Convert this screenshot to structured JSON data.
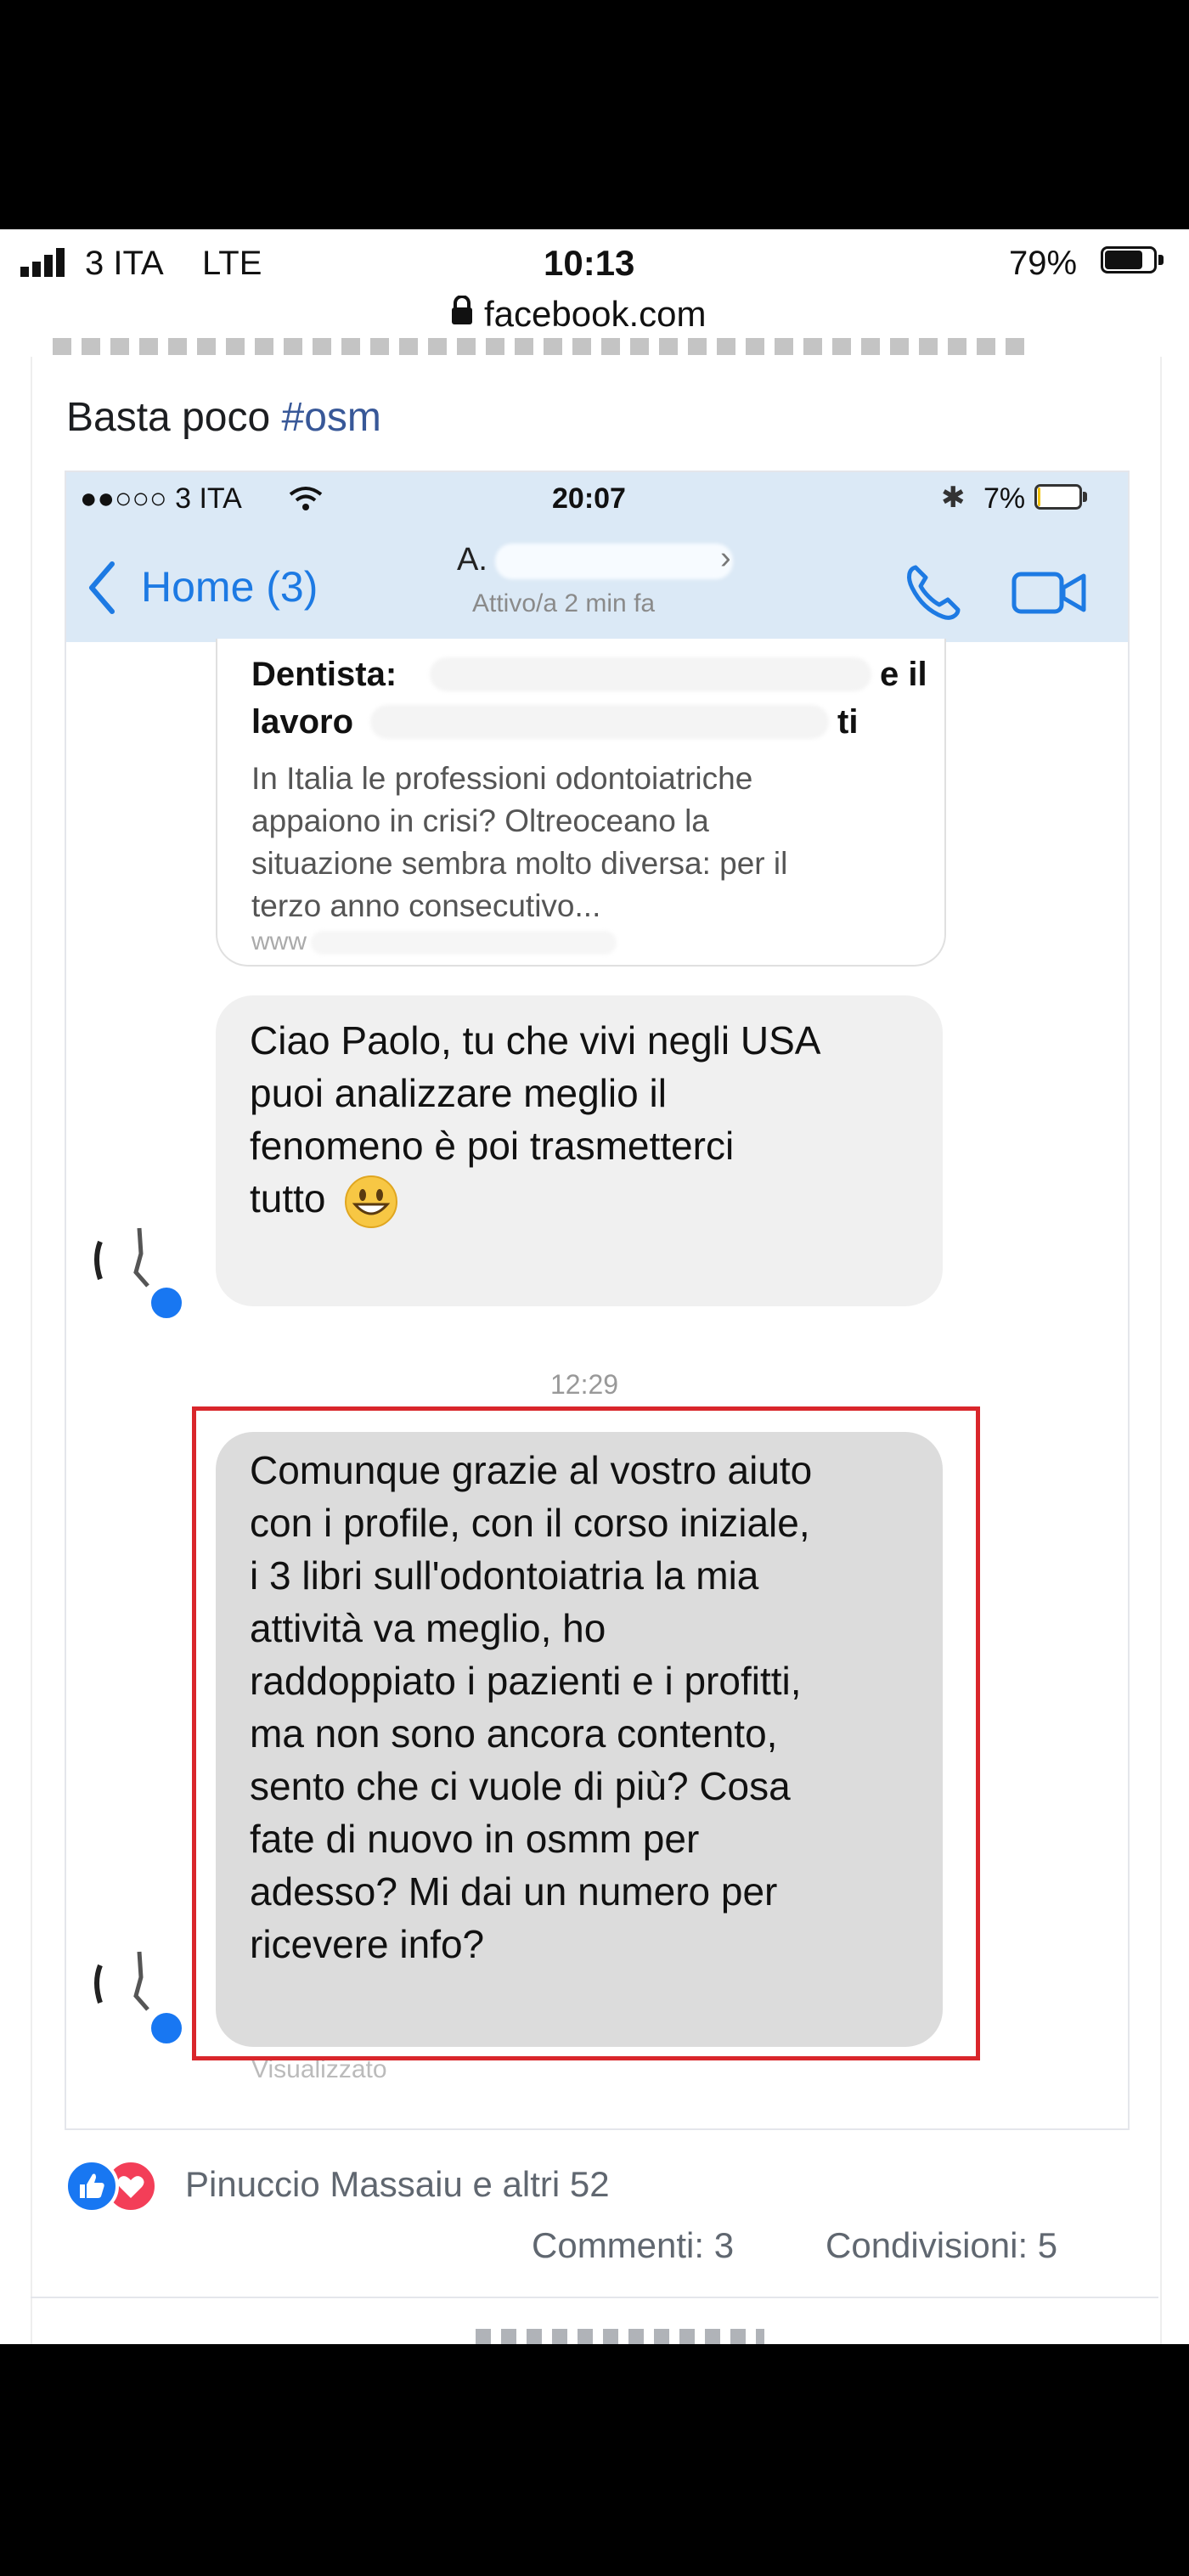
{
  "status_bar": {
    "carrier": "3 ITA",
    "network": "LTE",
    "time": "10:13",
    "battery_percent": "79%",
    "battery_level": 0.79,
    "url": "facebook.com"
  },
  "post": {
    "text_prefix": "Basta poco ",
    "hashtag": "#osm"
  },
  "inner_screenshot": {
    "status": {
      "carrier": "●●○○○ 3 ITA",
      "time": "20:07",
      "battery_percent": "7%",
      "battery_level": 0.07
    },
    "nav": {
      "back_label": "Home (3)",
      "contact_name": "A.",
      "contact_status": "Attivo/a 2 min fa"
    },
    "link_card": {
      "title_line1": "Dentista:",
      "title_line1_end": "e il",
      "title_line2": "lavoro",
      "title_line2_end": "ti",
      "description": [
        "In Italia le professioni odontoiatriche",
        "appaiono in crisi? Oltreoceano la",
        "situazione sembra molto diversa: per il",
        "terzo anno consecutivo..."
      ],
      "url": "www"
    },
    "messages": [
      {
        "lines": [
          "Ciao Paolo, tu che vivi negli USA",
          "puoi analizzare meglio il",
          "fenomeno è poi trasmetterci",
          "tutto"
        ],
        "emoji": "smiling-face"
      },
      {
        "lines": [
          "Comunque grazie al vostro aiuto",
          "con i profile, con il corso iniziale,",
          "i 3 libri sull'odontoiatria la mia",
          "attività va meglio, ho",
          "raddoppiato i pazienti e i profitti,",
          "ma non sono ancora contento,",
          "sento che ci vuole di più? Cosa",
          "fate di nuovo in osmm per",
          "adesso? Mi dai un numero per",
          "ricevere info?"
        ]
      }
    ],
    "timestamp": "12:29",
    "seen_label": "Visualizzato",
    "highlight_color": "#d9262b"
  },
  "reactions": {
    "text": "Pinuccio Massaiu e altri 52",
    "icons": [
      "like-icon",
      "love-icon"
    ],
    "comments": "Commenti: 3",
    "shares": "Condivisioni: 5"
  },
  "colors": {
    "facebook_blue": "#1877f2",
    "love_red": "#f33e58",
    "ios_blue": "#1d7ae3"
  }
}
